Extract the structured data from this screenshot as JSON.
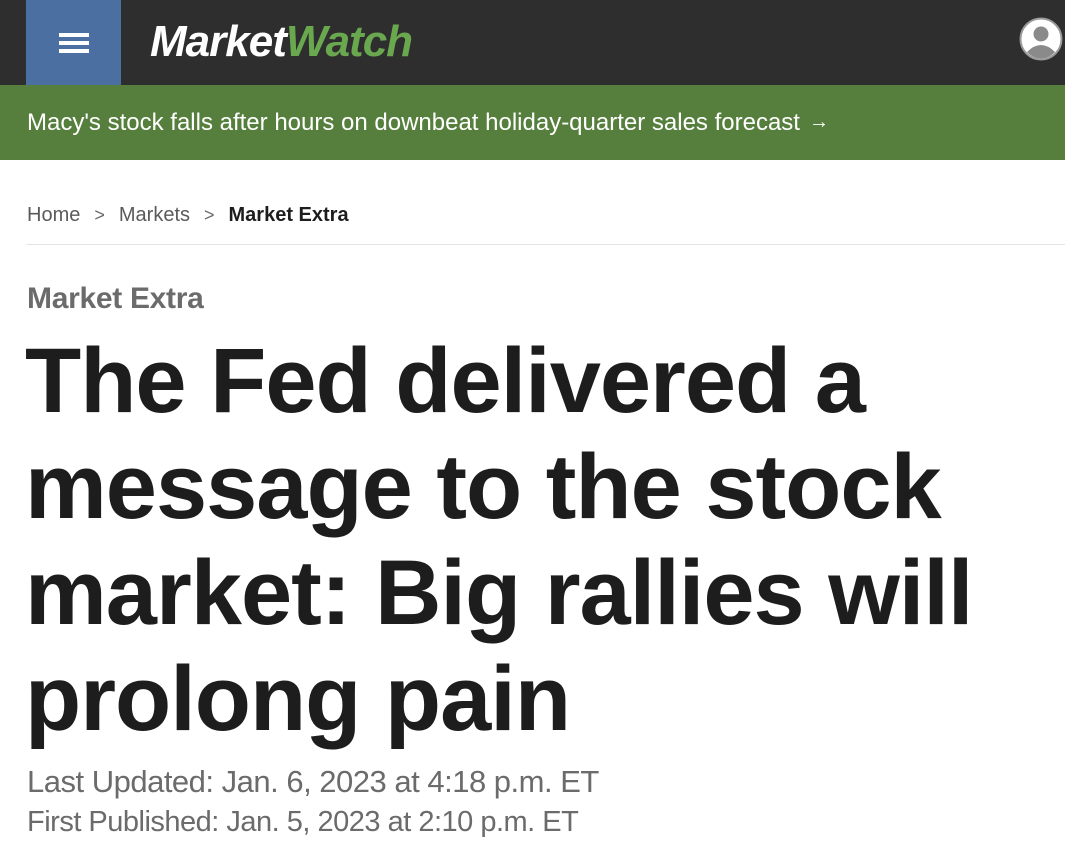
{
  "header": {
    "menu_icon": "hamburger-menu-icon",
    "logo_part1": "Market",
    "logo_part2": "Watch",
    "account_icon": "user-account-icon",
    "colors": {
      "bar": "#2e2e2e",
      "menu": "#4a6fa0",
      "brand_green": "#6aa84f"
    }
  },
  "banner": {
    "text": "Macy's stock falls after hours on downbeat holiday-quarter sales forecast",
    "arrow": "→",
    "color": "#567f3e"
  },
  "breadcrumb": {
    "items": [
      "Home",
      "Markets",
      "Market Extra"
    ],
    "separator": ">"
  },
  "article": {
    "section": "Market Extra",
    "headline": "The Fed delivered a message to the stock market: Big rallies will prolong pain",
    "last_updated": "Last Updated: Jan. 6, 2023 at 4:18 p.m. ET",
    "first_published": "First Published: Jan. 5, 2023 at 2:10 p.m. ET"
  }
}
